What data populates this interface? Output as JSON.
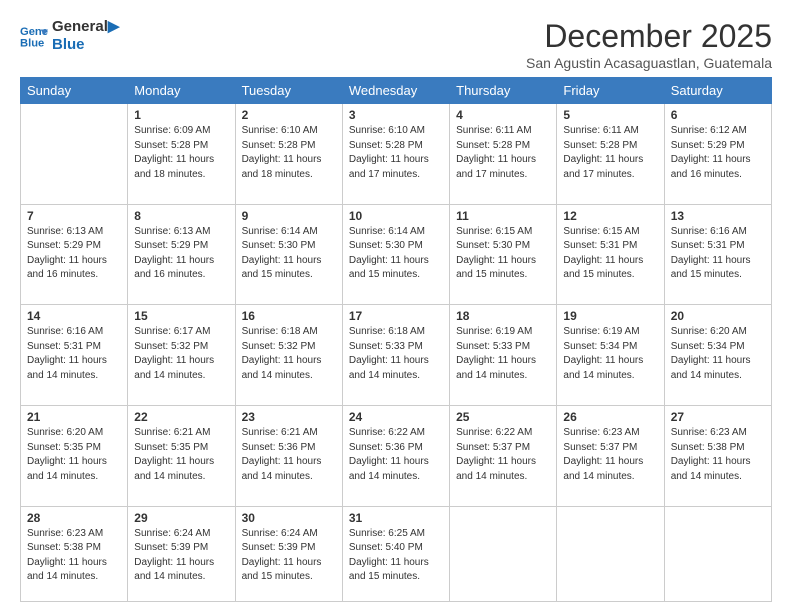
{
  "logo": {
    "line1": "General",
    "line2": "Blue"
  },
  "title": "December 2025",
  "subtitle": "San Agustin Acasaguastlan, Guatemala",
  "weekdays": [
    "Sunday",
    "Monday",
    "Tuesday",
    "Wednesday",
    "Thursday",
    "Friday",
    "Saturday"
  ],
  "weeks": [
    [
      {
        "day": "",
        "info": ""
      },
      {
        "day": "1",
        "info": "Sunrise: 6:09 AM\nSunset: 5:28 PM\nDaylight: 11 hours\nand 18 minutes."
      },
      {
        "day": "2",
        "info": "Sunrise: 6:10 AM\nSunset: 5:28 PM\nDaylight: 11 hours\nand 18 minutes."
      },
      {
        "day": "3",
        "info": "Sunrise: 6:10 AM\nSunset: 5:28 PM\nDaylight: 11 hours\nand 17 minutes."
      },
      {
        "day": "4",
        "info": "Sunrise: 6:11 AM\nSunset: 5:28 PM\nDaylight: 11 hours\nand 17 minutes."
      },
      {
        "day": "5",
        "info": "Sunrise: 6:11 AM\nSunset: 5:28 PM\nDaylight: 11 hours\nand 17 minutes."
      },
      {
        "day": "6",
        "info": "Sunrise: 6:12 AM\nSunset: 5:29 PM\nDaylight: 11 hours\nand 16 minutes."
      }
    ],
    [
      {
        "day": "7",
        "info": "Sunrise: 6:13 AM\nSunset: 5:29 PM\nDaylight: 11 hours\nand 16 minutes."
      },
      {
        "day": "8",
        "info": "Sunrise: 6:13 AM\nSunset: 5:29 PM\nDaylight: 11 hours\nand 16 minutes."
      },
      {
        "day": "9",
        "info": "Sunrise: 6:14 AM\nSunset: 5:30 PM\nDaylight: 11 hours\nand 15 minutes."
      },
      {
        "day": "10",
        "info": "Sunrise: 6:14 AM\nSunset: 5:30 PM\nDaylight: 11 hours\nand 15 minutes."
      },
      {
        "day": "11",
        "info": "Sunrise: 6:15 AM\nSunset: 5:30 PM\nDaylight: 11 hours\nand 15 minutes."
      },
      {
        "day": "12",
        "info": "Sunrise: 6:15 AM\nSunset: 5:31 PM\nDaylight: 11 hours\nand 15 minutes."
      },
      {
        "day": "13",
        "info": "Sunrise: 6:16 AM\nSunset: 5:31 PM\nDaylight: 11 hours\nand 15 minutes."
      }
    ],
    [
      {
        "day": "14",
        "info": "Sunrise: 6:16 AM\nSunset: 5:31 PM\nDaylight: 11 hours\nand 14 minutes."
      },
      {
        "day": "15",
        "info": "Sunrise: 6:17 AM\nSunset: 5:32 PM\nDaylight: 11 hours\nand 14 minutes."
      },
      {
        "day": "16",
        "info": "Sunrise: 6:18 AM\nSunset: 5:32 PM\nDaylight: 11 hours\nand 14 minutes."
      },
      {
        "day": "17",
        "info": "Sunrise: 6:18 AM\nSunset: 5:33 PM\nDaylight: 11 hours\nand 14 minutes."
      },
      {
        "day": "18",
        "info": "Sunrise: 6:19 AM\nSunset: 5:33 PM\nDaylight: 11 hours\nand 14 minutes."
      },
      {
        "day": "19",
        "info": "Sunrise: 6:19 AM\nSunset: 5:34 PM\nDaylight: 11 hours\nand 14 minutes."
      },
      {
        "day": "20",
        "info": "Sunrise: 6:20 AM\nSunset: 5:34 PM\nDaylight: 11 hours\nand 14 minutes."
      }
    ],
    [
      {
        "day": "21",
        "info": "Sunrise: 6:20 AM\nSunset: 5:35 PM\nDaylight: 11 hours\nand 14 minutes."
      },
      {
        "day": "22",
        "info": "Sunrise: 6:21 AM\nSunset: 5:35 PM\nDaylight: 11 hours\nand 14 minutes."
      },
      {
        "day": "23",
        "info": "Sunrise: 6:21 AM\nSunset: 5:36 PM\nDaylight: 11 hours\nand 14 minutes."
      },
      {
        "day": "24",
        "info": "Sunrise: 6:22 AM\nSunset: 5:36 PM\nDaylight: 11 hours\nand 14 minutes."
      },
      {
        "day": "25",
        "info": "Sunrise: 6:22 AM\nSunset: 5:37 PM\nDaylight: 11 hours\nand 14 minutes."
      },
      {
        "day": "26",
        "info": "Sunrise: 6:23 AM\nSunset: 5:37 PM\nDaylight: 11 hours\nand 14 minutes."
      },
      {
        "day": "27",
        "info": "Sunrise: 6:23 AM\nSunset: 5:38 PM\nDaylight: 11 hours\nand 14 minutes."
      }
    ],
    [
      {
        "day": "28",
        "info": "Sunrise: 6:23 AM\nSunset: 5:38 PM\nDaylight: 11 hours\nand 14 minutes."
      },
      {
        "day": "29",
        "info": "Sunrise: 6:24 AM\nSunset: 5:39 PM\nDaylight: 11 hours\nand 14 minutes."
      },
      {
        "day": "30",
        "info": "Sunrise: 6:24 AM\nSunset: 5:39 PM\nDaylight: 11 hours\nand 15 minutes."
      },
      {
        "day": "31",
        "info": "Sunrise: 6:25 AM\nSunset: 5:40 PM\nDaylight: 11 hours\nand 15 minutes."
      },
      {
        "day": "",
        "info": ""
      },
      {
        "day": "",
        "info": ""
      },
      {
        "day": "",
        "info": ""
      }
    ]
  ]
}
